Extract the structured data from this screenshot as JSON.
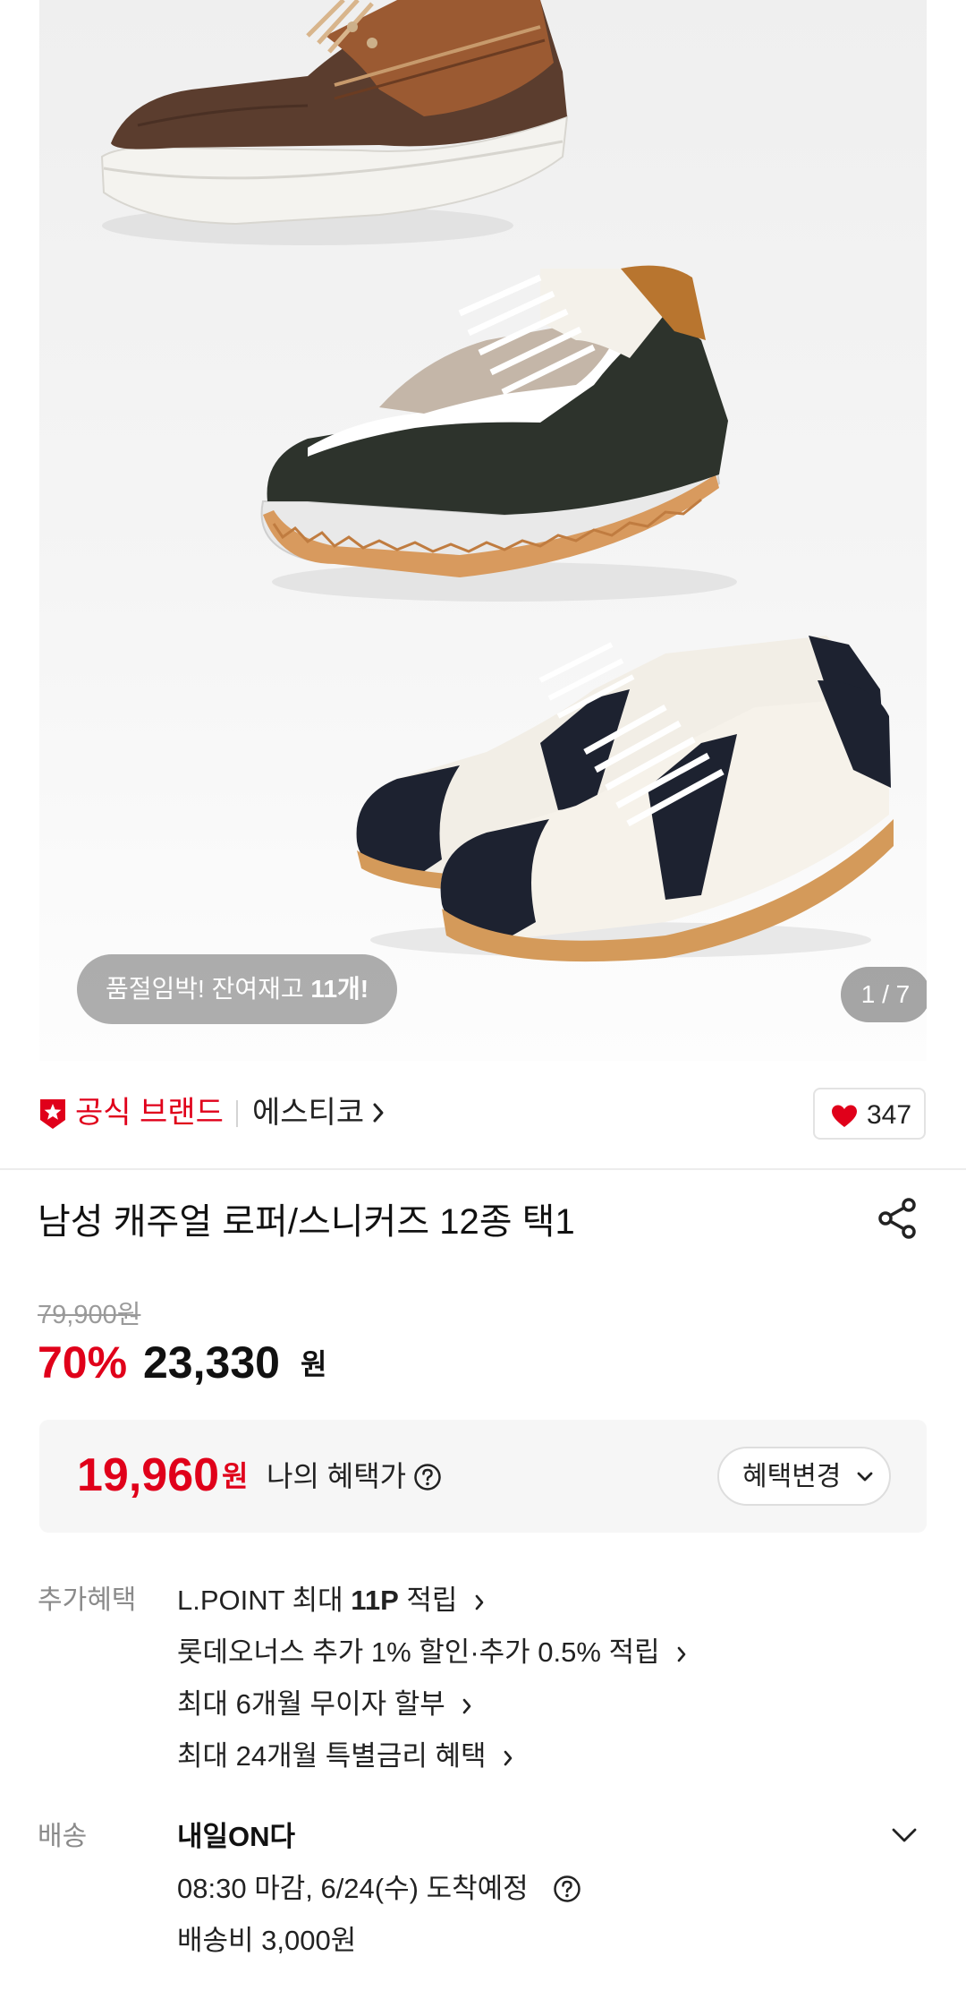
{
  "gallery": {
    "stock_notice_prefix": "품절임박! 잔여재고 ",
    "stock_notice_count": "11개!",
    "page_indicator": "1 / 7",
    "image_icon": "sneaker-product-image"
  },
  "brand": {
    "official_label": "공식 브랜드",
    "name": "에스티코",
    "badge_icon": "official-brand-badge-icon",
    "like_count": "347"
  },
  "product": {
    "title": "남성 캐주얼 로퍼/스니커즈 12종 택1"
  },
  "price": {
    "original": "79,900원",
    "discount_rate": "70%",
    "sale": "23,330",
    "sale_unit": "원"
  },
  "benefit": {
    "price": "19,960",
    "unit": "원",
    "label": "나의 혜택가",
    "change_button": "혜택변경"
  },
  "extra_benefits": {
    "label": "추가혜택",
    "items": [
      {
        "pre": "L.POINT 최대 ",
        "bold": "11P",
        "post": " 적립"
      },
      {
        "pre": "롯데오너스 추가 1% 할인·추가 0.5% 적립",
        "bold": "",
        "post": ""
      },
      {
        "pre": "최대 6개월 무이자 할부",
        "bold": "",
        "post": ""
      },
      {
        "pre": "최대 24개월 특별금리 혜택",
        "bold": "",
        "post": ""
      }
    ]
  },
  "delivery": {
    "label": "배송",
    "title": "내일ON다",
    "eta": "08:30 마감, 6/24(수) 도착예정",
    "fee": "배송비 3,000원"
  },
  "colors": {
    "accent_red": "#e0001a",
    "muted_gray": "#8a8a8a"
  }
}
